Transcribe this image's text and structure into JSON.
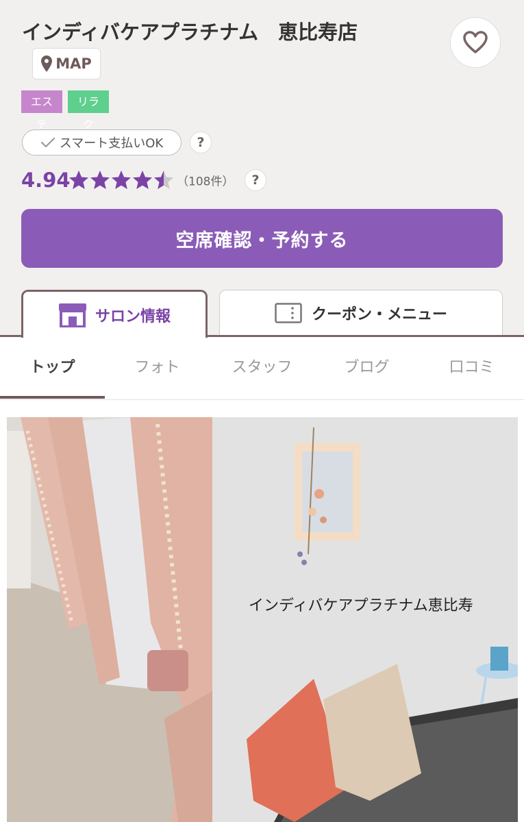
{
  "header": {
    "title": "インディバケアプラチナム　恵比寿店",
    "favorite_icon": "heart-icon",
    "map_label": "MAP",
    "map_icon": "pin-icon"
  },
  "tags": [
    "エステ",
    "リラク"
  ],
  "payment": {
    "label": "スマート支払いOK",
    "icon": "check-icon",
    "help_label": "?"
  },
  "rating": {
    "score": "4.94",
    "stars": 4.5,
    "count": "（108件）",
    "help_label": "?"
  },
  "reserve_button": "空席確認・予約する",
  "main_tabs": [
    {
      "label": "サロン情報",
      "icon": "store-icon",
      "active": true
    },
    {
      "label": "クーポン・メニュー",
      "icon": "coupon-icon",
      "active": false
    }
  ],
  "sub_tabs": [
    "トップ",
    "フォト",
    "スタッフ",
    "ブログ",
    "口コミ"
  ],
  "photo": {
    "caption": "インディバケアプラチナム恵比寿"
  },
  "colors": {
    "brand": "#8a5cb8",
    "rating": "#7b43a6",
    "tag_este": "#c686cc",
    "tag_relax": "#5fcf8e",
    "tab_border": "#7b6466"
  }
}
